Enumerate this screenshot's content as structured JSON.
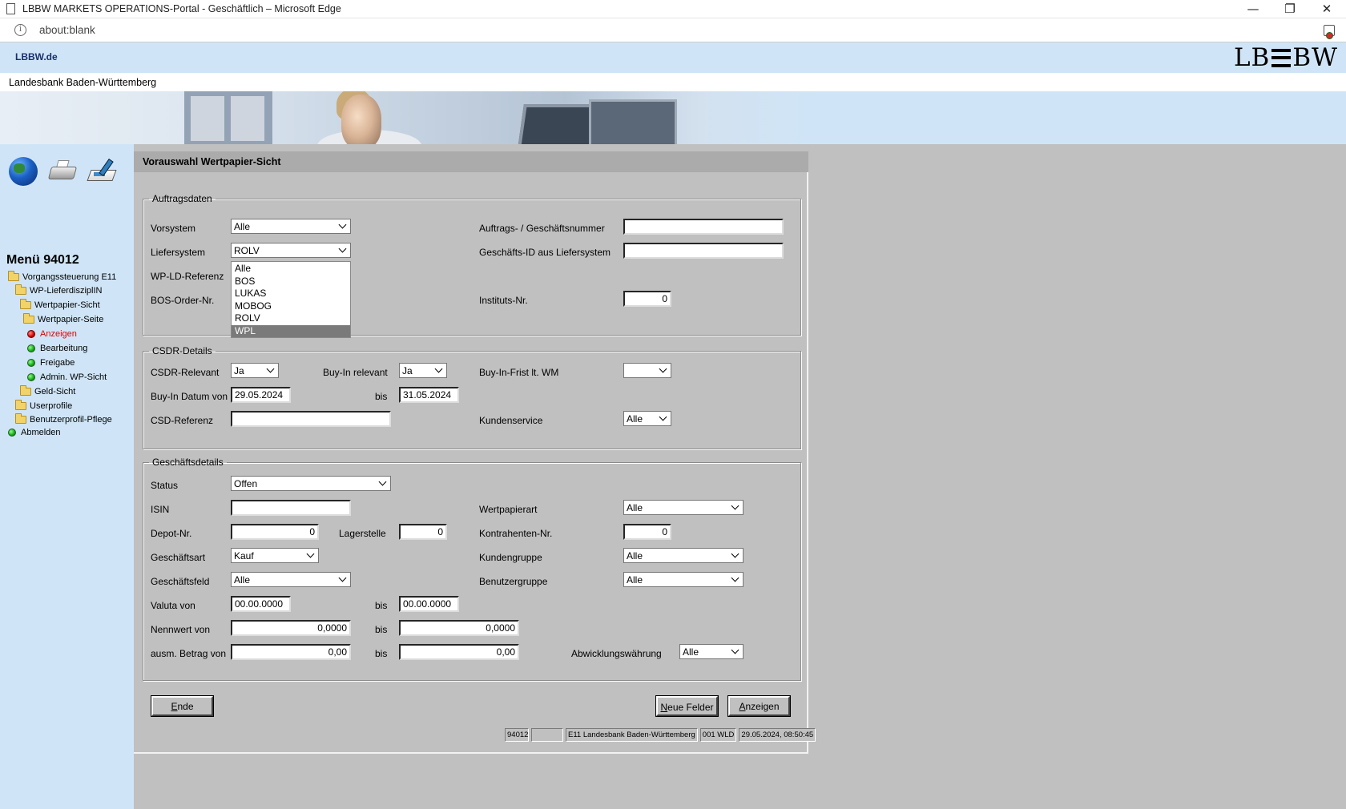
{
  "browser": {
    "window_title": "LBBW MARKETS OPERATIONS-Portal - Geschäftlich – Microsoft Edge",
    "url": "about:blank",
    "controls": {
      "minimize": "—",
      "restore": "❐",
      "close": "✕"
    }
  },
  "site": {
    "top_link": "LBBW.de",
    "logo_left": "LB",
    "logo_right": "BW",
    "bank_name": "Landesbank Baden-Württemberg"
  },
  "menu": {
    "title": "Menü 94012",
    "items": [
      {
        "label": "Vorgangssteuerung E11",
        "icon": "folder-icon"
      },
      {
        "label": "WP-LieferdisziplIN",
        "icon": "folder-icon"
      },
      {
        "label": "Wertpapier-Sicht",
        "icon": "folder-icon"
      },
      {
        "label": "Wertpapier-Seite",
        "icon": "folder-icon"
      },
      {
        "label": "Anzeigen",
        "icon": "red-dot-icon",
        "active": true
      },
      {
        "label": "Bearbeitung",
        "icon": "green-dot-icon"
      },
      {
        "label": "Freigabe",
        "icon": "green-dot-icon"
      },
      {
        "label": "Admin. WP-Sicht",
        "icon": "green-dot-icon"
      },
      {
        "label": "Geld-Sicht",
        "icon": "folder-icon"
      },
      {
        "label": "Userprofile",
        "icon": "folder-icon"
      },
      {
        "label": "Benutzerprofil-Pflege",
        "icon": "folder-icon"
      },
      {
        "label": "Abmelden",
        "icon": "green-dot-icon"
      }
    ]
  },
  "form": {
    "title": "Vorauswahl Wertpapier-Sicht",
    "auftragsdaten": {
      "legend": "Auftragsdaten",
      "vorsystem": {
        "label": "Vorsystem",
        "value": "Alle"
      },
      "liefersystem": {
        "label": "Liefersystem",
        "value": "ROLV",
        "options": [
          "Alle",
          "BOS",
          "LUKAS",
          "MOBOG",
          "ROLV",
          "WPL"
        ],
        "highlighted": "WPL"
      },
      "wp_ld_referenz": {
        "label": "WP-LD-Referenz"
      },
      "bos_order": {
        "label": "BOS-Order-Nr."
      },
      "auftragsnummer": {
        "label": "Auftrags- / Geschäftsnummer",
        "value": ""
      },
      "geschaefts_id": {
        "label": "Geschäfts-ID aus Liefersystem",
        "value": ""
      },
      "instituts_nr": {
        "label": "Instituts-Nr.",
        "value": "0"
      }
    },
    "csdr": {
      "legend": "CSDR-Details",
      "relevant": {
        "label": "CSDR-Relevant",
        "value": "Ja"
      },
      "buyin_relevant": {
        "label": "Buy-In relevant",
        "value": "Ja"
      },
      "buyin_frist": {
        "label": "Buy-In-Frist lt. WM",
        "value": ""
      },
      "buyin_datum_von": {
        "label": "Buy-In Datum von",
        "value": "29.05.2024"
      },
      "buyin_datum_bis": {
        "label": "bis",
        "value": "31.05.2024"
      },
      "csd_referenz": {
        "label": "CSD-Referenz",
        "value": ""
      },
      "kundenservice": {
        "label": "Kundenservice",
        "value": "Alle"
      }
    },
    "geschaeft": {
      "legend": "Geschäftsdetails",
      "status": {
        "label": "Status",
        "value": "Offen"
      },
      "isin": {
        "label": "ISIN",
        "value": ""
      },
      "wertpapierart": {
        "label": "Wertpapierart",
        "value": "Alle"
      },
      "depot_nr": {
        "label": "Depot-Nr.",
        "value": "0"
      },
      "lagerstelle": {
        "label": "Lagerstelle",
        "value": "0"
      },
      "kontrahenten_nr": {
        "label": "Kontrahenten-Nr.",
        "value": "0"
      },
      "geschaeftsart": {
        "label": "Geschäftsart",
        "value": "Kauf"
      },
      "kundengruppe": {
        "label": "Kundengruppe",
        "value": "Alle"
      },
      "geschaeftsfeld": {
        "label": "Geschäftsfeld",
        "value": "Alle"
      },
      "benutzergruppe": {
        "label": "Benutzergruppe",
        "value": "Alle"
      },
      "valuta_von": {
        "label": "Valuta von",
        "value": "00.00.0000"
      },
      "valuta_bis": {
        "label": "bis",
        "value": "00.00.0000"
      },
      "nennwert_von": {
        "label": "Nennwert von",
        "value": "0,0000"
      },
      "nennwert_bis": {
        "label": "bis",
        "value": "0,0000"
      },
      "betrag_von": {
        "label": "ausm. Betrag von",
        "value": "0,00"
      },
      "betrag_bis": {
        "label": "bis",
        "value": "0,00"
      },
      "abwicklungswaehrung": {
        "label": "Abwicklungswährung",
        "value": "Alle"
      }
    },
    "buttons": {
      "ende": {
        "underlined": "E",
        "rest": "nde"
      },
      "neue_felder": {
        "underlined": "N",
        "rest": "eue Felder"
      },
      "anzeigen": {
        "underlined": "A",
        "rest": "nzeigen"
      }
    },
    "statusbar": [
      "94012",
      "",
      "E11 Landesbank Baden-Württemberg",
      "001 WLD",
      "29.05.2024, 08:50:45"
    ]
  }
}
